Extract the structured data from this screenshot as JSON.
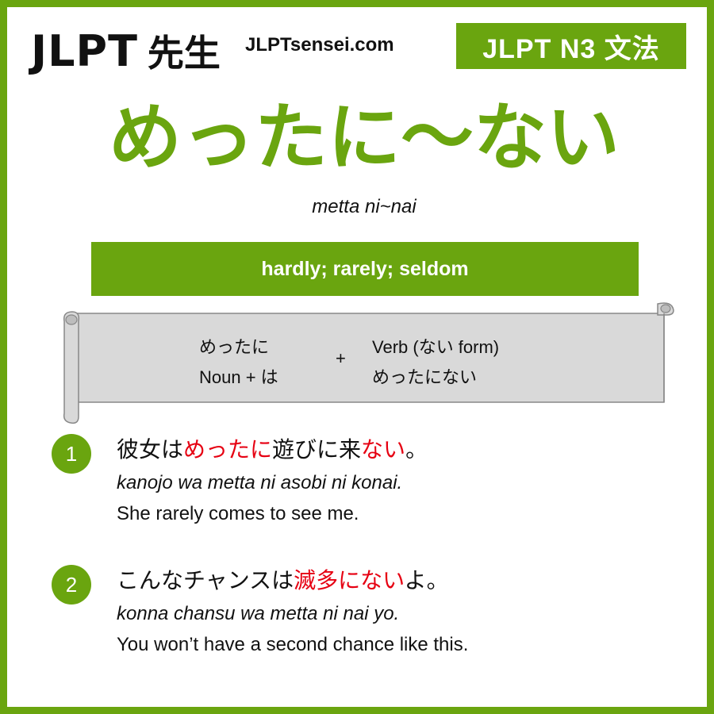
{
  "header": {
    "logo_text": "JLPT",
    "logo_kanji": "先生",
    "site": "JLPTsensei.com",
    "level_badge": "JLPT N3 文法"
  },
  "grammar": {
    "title": "めったに〜ない",
    "romaji": "metta ni~nai",
    "meaning": "hardly; rarely; seldom"
  },
  "formation": {
    "left_line1": "めったに",
    "left_line2": "Noun + は",
    "plus": "+",
    "right_line1": "Verb (ない form)",
    "right_line2": "めったにない"
  },
  "examples": [
    {
      "number": "1",
      "jp_parts": [
        "彼女は",
        "めったに",
        "遊びに来",
        "ない",
        "。"
      ],
      "romaji": "kanojo wa metta ni asobi ni konai.",
      "english": "She rarely comes to see me."
    },
    {
      "number": "2",
      "jp_parts": [
        "こんなチャンスは",
        "滅多にない",
        "よ。"
      ],
      "romaji": "konna chansu wa metta ni nai yo.",
      "english": "You won’t have a second chance like this."
    }
  ],
  "colors": {
    "accent": "#6aa50f",
    "highlight": "#e60012",
    "scroll_fill": "#d9d9d9"
  }
}
